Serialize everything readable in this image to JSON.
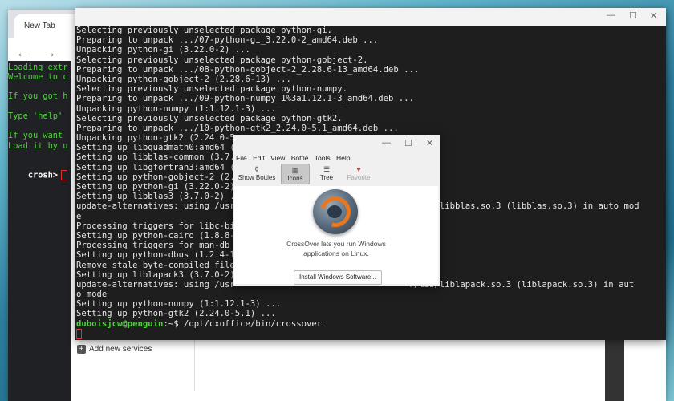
{
  "browser": {
    "tab_title": "New Tab",
    "back_icon": "←",
    "forward_icon": "→",
    "add_service_label": "Add new services"
  },
  "crosh": {
    "lines": [
      "Loading extr",
      "Welcome to c",
      "",
      "If you got h",
      "",
      "Type 'help'",
      "",
      "If you want",
      "Load it by u"
    ],
    "prompt": "crosh>"
  },
  "terminal": {
    "lines": [
      "Selecting previously unselected package python-gi.",
      "Preparing to unpack .../07-python-gi_3.22.0-2_amd64.deb ...",
      "Unpacking python-gi (3.22.0-2) ...",
      "Selecting previously unselected package python-gobject-2.",
      "Preparing to unpack .../08-python-gobject-2_2.28.6-13_amd64.deb ...",
      "Unpacking python-gobject-2 (2.28.6-13) ...",
      "Selecting previously unselected package python-numpy.",
      "Preparing to unpack .../09-python-numpy_1%3a1.12.1-3_amd64.deb ...",
      "Unpacking python-numpy (1:1.12.1-3) ...",
      "Selecting previously unselected package python-gtk2.",
      "Preparing to unpack .../10-python-gtk2_2.24.0-5.1_amd64.deb ...",
      "Unpacking python-gtk2 (2.24.0-5",
      "Setting up libquadmath0:amd64 (",
      "Setting up libblas-common (3.7.",
      "Setting up libgfortran3:amd64 (",
      "Setting up python-gobject-2 (2.",
      "Setting up python-gi (3.22.0-2)",
      "Setting up libblas3 (3.7.0-2) .",
      "update-alternatives: using /usr                                  r/lib/libblas.so.3 (libblas.so.3) in auto mod",
      "e",
      "Processing triggers for libc-bi",
      "Setting up python-cairo (1.8.8-",
      "Processing triggers for man-db",
      "Setting up python-dbus (1.2.4-1",
      "Remove stale byte-compiled file",
      "Setting up liblapack3 (3.7.0-2)",
      "update-alternatives: using /usr                                  r/lib/liblapack.so.3 (liblapack.so.3) in aut",
      "o mode",
      "Setting up python-numpy (1:1.12.1-3) ...",
      "Setting up python-gtk2 (2.24.0-5.1) ..."
    ],
    "prompt_user": "duboisjcw@penguin",
    "prompt_rest": ":~$ /opt/cxoffice/bin/crossover",
    "minimize": "—",
    "maximize": "☐",
    "close": "✕"
  },
  "crossover": {
    "menu": [
      "File",
      "Edit",
      "View",
      "Bottle",
      "Tools",
      "Help"
    ],
    "tools": {
      "show_bottles": "Show Bottles",
      "icons": "Icons",
      "tree": "Tree",
      "favorite": "Favorite"
    },
    "message_line1": "CrossOver lets you run Windows",
    "message_line2": "applications on Linux.",
    "install_button": "Install Windows Software...",
    "minimize": "—",
    "maximize": "☐",
    "close": "✕"
  }
}
